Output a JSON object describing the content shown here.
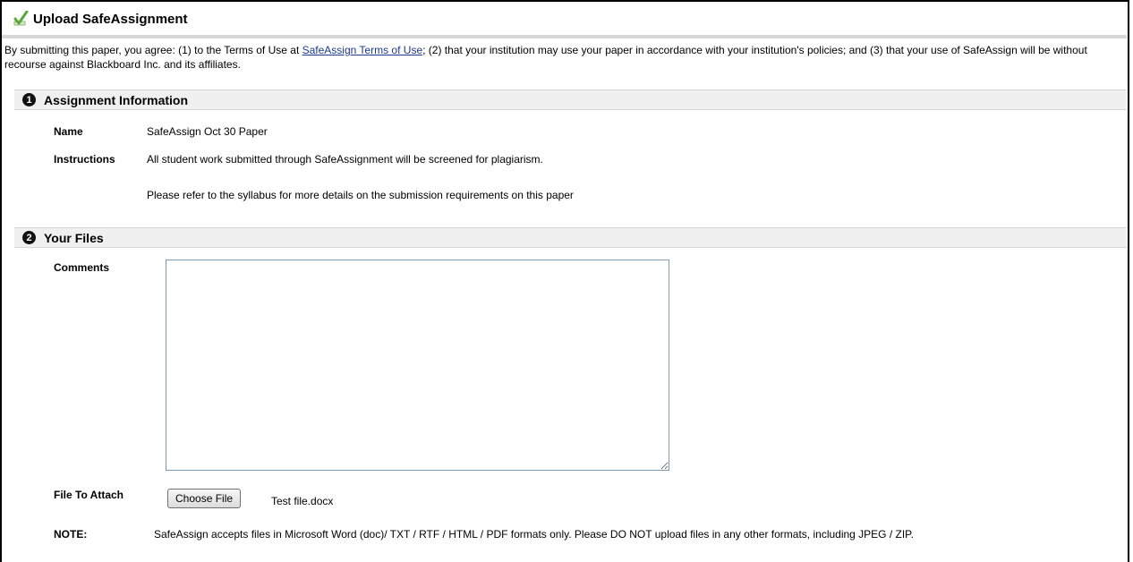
{
  "page": {
    "title": "Upload SafeAssignment",
    "terms": {
      "before_link": "By submitting this paper, you agree: (1) to the Terms of Use at ",
      "link": "SafeAssign Terms of Use",
      "after_link": "; (2) that your institution may use your paper in accordance with your institution's policies; and (3) that your use of SafeAssign will be without recourse against Blackboard Inc. and its affiliates."
    }
  },
  "assignment_info": {
    "step": "1",
    "heading": "Assignment Information",
    "name_label": "Name",
    "name_value": "SafeAssign Oct 30 Paper",
    "instructions_label": "Instructions",
    "instructions_line1": "All student work submitted through SafeAssignment will be screened for plagiarism.",
    "instructions_line2": "Please refer to the syllabus for more details on the submission requirements on this paper"
  },
  "your_files": {
    "step": "2",
    "heading": "Your Files",
    "comments_label": "Comments",
    "comments_value": "",
    "file_label": "File To Attach",
    "choose_file_label": "Choose File",
    "file_name": "Test file.docx",
    "note_label": "NOTE:",
    "note_text": "SafeAssign accepts files in Microsoft Word (doc)/ TXT / RTF / HTML / PDF formats only. Please DO NOT upload files in any other formats, including JPEG / ZIP."
  },
  "icons": {
    "title_icon": "check-icon"
  },
  "colors": {
    "link": "#1c3a8e",
    "section_bg": "#f0f0f0",
    "check_green": "#5aa83a"
  }
}
